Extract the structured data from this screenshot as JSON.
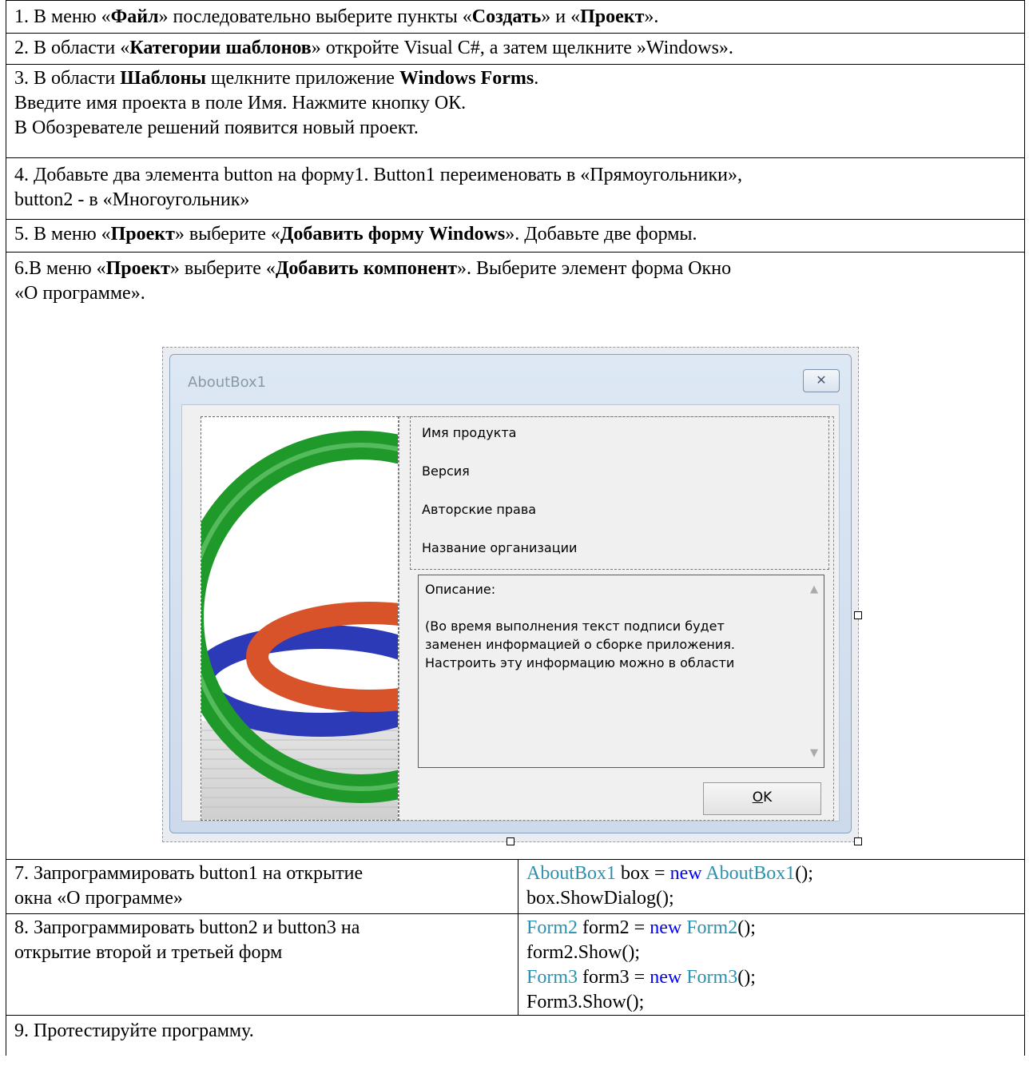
{
  "steps": {
    "s1": {
      "a": "1. В меню «",
      "b1": "Файл",
      "c": "» последовательно выберите пункты «",
      "b2": "Создать",
      "d": "» и «",
      "b3": "Проект",
      "e": "»."
    },
    "s2": {
      "a": "2. В области «",
      "b1": "Категории шаблонов",
      "c": "» откройте Visual C#, а затем щелкните »Windows»."
    },
    "s3": {
      "a": "3. В области ",
      "b1": "Шаблоны",
      "c": " щелкните приложение ",
      "b2": "Windows Forms",
      "d": ".",
      "line2": "Введите имя проекта в поле Имя. Нажмите кнопку ОК.",
      "line3": "В Обозревателе решений появится новый проект."
    },
    "s4": {
      "line1": "4. Добавьте два элемента button на форму1. Button1 переименовать в «Прямоугольники»,",
      "line2": "button2 - в «Многоугольник»"
    },
    "s5": {
      "a": "5. В меню «",
      "b1": "Проект",
      "c": "» выберите «",
      "b2": "Добавить форму Windows",
      "d": "».  Добавьте две формы."
    },
    "s6": {
      "a": "6.В меню «",
      "b1": "Проект",
      "c": "» выберите «",
      "b2": "Добавить компонент",
      "d": "».  Выберите элемент форма Окно",
      "line2": "«О программе»."
    },
    "s7": {
      "left1": "7. Запрограммировать  button1 на открытие",
      "left2": "окна «О программе»",
      "code1_type": "AboutBox1",
      "code1_mid": " box = ",
      "code1_kw": "new",
      "code1_sp": " ",
      "code1_type2": "AboutBox1",
      "code1_end": "();",
      "code2": "box.ShowDialog();"
    },
    "s8": {
      "left1": "8. Запрограммировать button2 и button3 на",
      "left2": "открытие второй и третьей форм",
      "c1_type": "Form2",
      "c1_mid": " form2 = ",
      "c1_kw": "new",
      "c1_sp": " ",
      "c1_type2": "Form2",
      "c1_end": "();",
      "c2": "form2.Show();",
      "c3_type": "Form3",
      "c3_mid": " form3 = ",
      "c3_kw": "new",
      "c3_sp": " ",
      "c3_type2": "Form3",
      "c3_end": "();",
      "c4": "Form3.Show();"
    },
    "s9": "9. Протестируйте программу."
  },
  "aboutbox": {
    "title": "AboutBox1",
    "close_glyph": "✕",
    "product": "Имя продукта",
    "version": "Версия",
    "copyright": "Авторские права",
    "company": "Название организации",
    "desc_title": "Описание:",
    "desc_l1": "(Во время выполнения текст подписи будет",
    "desc_l2": "заменен информацией о сборке приложения.",
    "desc_l3": "Настроить эту информацию можно в области",
    "ok_u": "О",
    "ok_rest": "K",
    "scroll_up": "▲",
    "scroll_down": "▼"
  },
  "colors": {
    "type": "#2b91af",
    "keyword": "#0000ff",
    "ring_green": "#1f9a2a",
    "ring_red": "#d9532a",
    "ring_blue": "#2c3ab8"
  }
}
